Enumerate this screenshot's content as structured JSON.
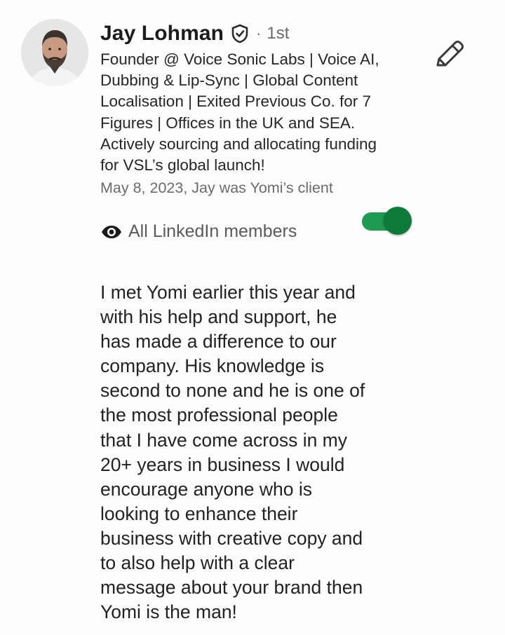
{
  "recommender": {
    "name": "Jay Lohman",
    "connection_separator": "·",
    "connection_degree": "1st",
    "headline_lines": [
      "Founder @ Voice Sonic Labs | Voice AI,",
      "Dubbing & Lip-Sync | Global Content",
      "Localisation | Exited Previous Co. for 7",
      "Figures | Offices in the UK and SEA.",
      "Actively sourcing and allocating funding",
      "for VSL’s global launch!"
    ],
    "relationship": "May 8, 2023, Jay was Yomi’s client"
  },
  "icons": {
    "avatar": "profile-photo",
    "verified": "verified-shield-icon",
    "edit": "pencil-icon",
    "visibility": "eye-icon"
  },
  "visibility": {
    "label": "All LinkedIn members",
    "toggle_on": true
  },
  "recommendation": {
    "lines": [
      "I met Yomi earlier this year and",
      "with his help and support, he",
      "has made a difference to our",
      "company. His knowledge is",
      "second to none and he is one of",
      "the most professional people",
      "that I have come across in my",
      "20+ years in business I would",
      "encourage anyone who is",
      "looking to enhance their",
      "business with creative copy and",
      "to also help with a clear",
      "message about your brand then",
      "Yomi is the man!"
    ]
  },
  "colors": {
    "toggle_track": "#1e9a52",
    "toggle_thumb": "#0e7a3a",
    "secondary_text": "#6b6b6b"
  }
}
